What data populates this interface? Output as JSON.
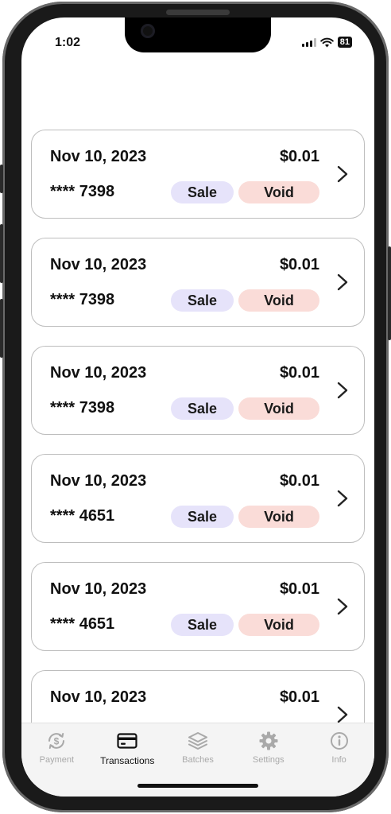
{
  "status_bar": {
    "time": "1:02",
    "battery": "81"
  },
  "transactions": [
    {
      "date": "Nov 10, 2023",
      "amount": "$0.01",
      "card": "**** 7398",
      "type": "Sale",
      "status": "Void"
    },
    {
      "date": "Nov 10, 2023",
      "amount": "$0.01",
      "card": "**** 7398",
      "type": "Sale",
      "status": "Void"
    },
    {
      "date": "Nov 10, 2023",
      "amount": "$0.01",
      "card": "**** 7398",
      "type": "Sale",
      "status": "Void"
    },
    {
      "date": "Nov 10, 2023",
      "amount": "$0.01",
      "card": "**** 4651",
      "type": "Sale",
      "status": "Void"
    },
    {
      "date": "Nov 10, 2023",
      "amount": "$0.01",
      "card": "**** 4651",
      "type": "Sale",
      "status": "Void"
    },
    {
      "date": "Nov 10, 2023",
      "amount": "$0.01",
      "card": "",
      "type": "",
      "status": ""
    }
  ],
  "tabs": [
    {
      "label": "Payment",
      "icon": "dollar-sync-icon",
      "active": false
    },
    {
      "label": "Transactions",
      "icon": "credit-card-icon",
      "active": true
    },
    {
      "label": "Batches",
      "icon": "layers-icon",
      "active": false
    },
    {
      "label": "Settings",
      "icon": "gear-icon",
      "active": false
    },
    {
      "label": "Info",
      "icon": "info-icon",
      "active": false
    }
  ],
  "colors": {
    "sale_pill": "#e6e3fa",
    "void_pill": "#fadcd8",
    "active_tab": "#111111",
    "inactive_tab": "#a9a9a9"
  }
}
